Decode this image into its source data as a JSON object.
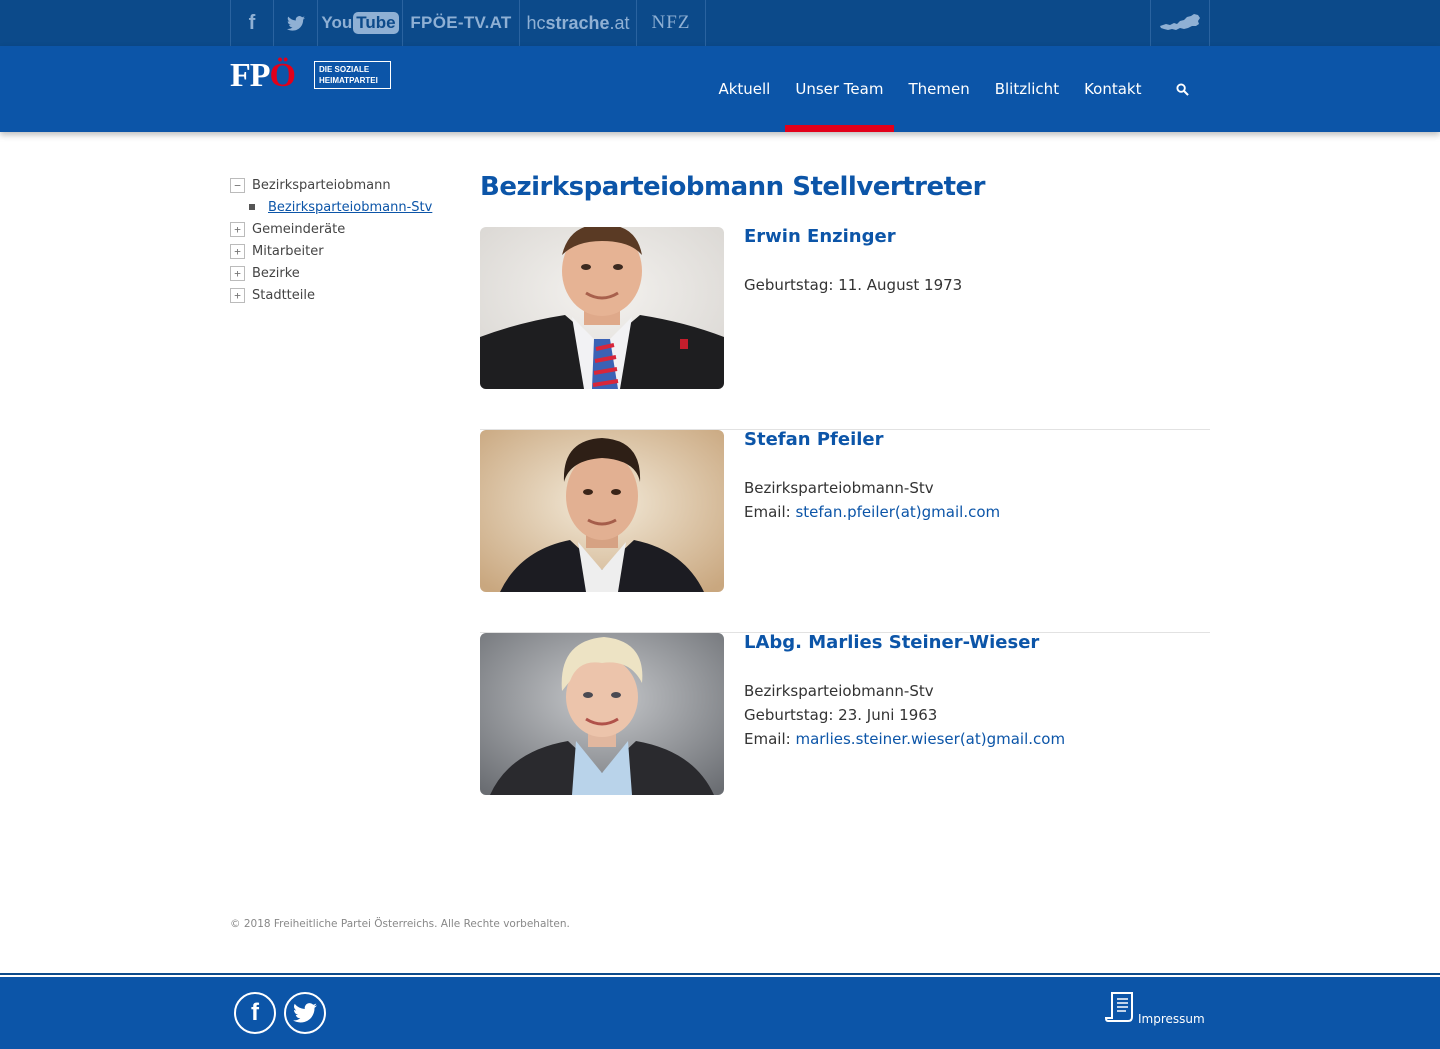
{
  "topbar": {
    "facebook_label": "f",
    "youtube": {
      "you": "You",
      "tube": "Tube"
    },
    "fpoe_tv": "FPÖE-TV.AT",
    "hcstrache": {
      "hc": "hc",
      "strache": "strache",
      "at": ".at"
    },
    "nfz": "NFZ"
  },
  "header": {
    "logo": {
      "letters_fp": "FP",
      "letter_o": "Ö",
      "tag_line1": "DIE SOZIALE",
      "tag_line2": "HEIMATPARTEI"
    },
    "nav": [
      {
        "label": "Aktuell",
        "active": false
      },
      {
        "label": "Unser Team",
        "active": true
      },
      {
        "label": "Themen",
        "active": false
      },
      {
        "label": "Blitzlicht",
        "active": false
      },
      {
        "label": "Kontakt",
        "active": false
      }
    ]
  },
  "sidebar": {
    "items": [
      {
        "toggle": "−",
        "label": "Bezirksparteiobmann"
      },
      {
        "label": "Bezirksparteiobmann-Stv"
      },
      {
        "toggle": "+",
        "label": "Gemeinderäte"
      },
      {
        "toggle": "+",
        "label": "Mitarbeiter"
      },
      {
        "toggle": "+",
        "label": "Bezirke"
      },
      {
        "toggle": "+",
        "label": "Stadtteile"
      }
    ]
  },
  "main": {
    "title": "Bezirksparteiobmann Stellvertreter",
    "people": [
      {
        "name": "Erwin Enzinger",
        "birthday": "Geburtstag: 11. August 1973"
      },
      {
        "name": "Stefan Pfeiler",
        "role": "Bezirksparteiobmann-Stv",
        "email_label": "Email: ",
        "email": "stefan.pfeiler(at)gmail.com"
      },
      {
        "name": "LAbg. Marlies Steiner-Wieser",
        "role": "Bezirksparteiobmann-Stv",
        "birthday": "Geburtstag: 23. Juni 1963",
        "email_label": "Email: ",
        "email": "marlies.steiner.wieser(at)gmail.com"
      }
    ]
  },
  "footer": {
    "copyright": "© 2018 Freiheitliche Partei Österreichs. Alle Rechte vorbehalten.",
    "facebook_label": "f",
    "impressum": "Impressum"
  },
  "colors": {
    "topbar": "#0c4a8a",
    "header": "#0c55a8",
    "accent_red": "#e2001a",
    "link_blue": "#0c55a8"
  }
}
